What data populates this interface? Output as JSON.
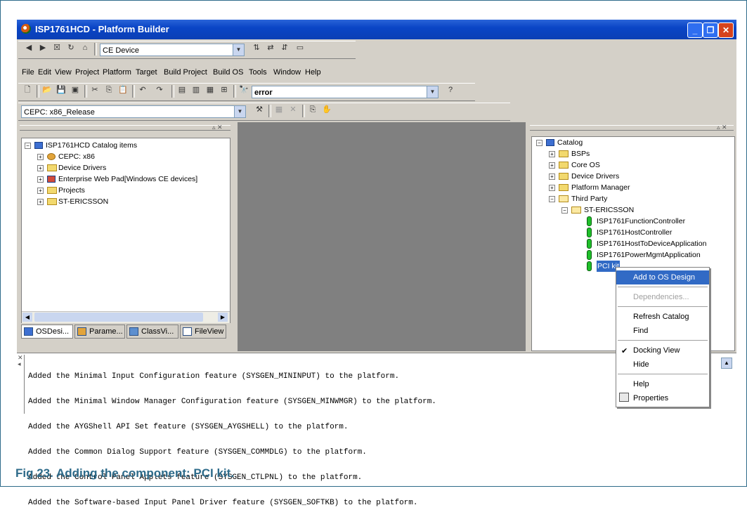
{
  "window": {
    "title": "ISP1761HCD - Platform Builder"
  },
  "toolbar1": {
    "device_combo": "CE Device"
  },
  "menu": [
    "File",
    "Edit",
    "View",
    "Project",
    "Platform",
    "Target",
    "Build Project",
    "Build OS",
    "Tools",
    "Window",
    "Help"
  ],
  "toolbar2": {
    "search_combo": "error"
  },
  "toolbar3": {
    "config_combo": "CEPC: x86_Release"
  },
  "left_tree": {
    "root": "ISP1761HCD Catalog items",
    "items": [
      "CEPC: x86",
      "Device Drivers",
      "Enterprise Web Pad[Windows CE devices]",
      "Projects",
      "ST-ERICSSON"
    ]
  },
  "left_tabs": [
    "OSDesi...",
    "Parame...",
    "ClassVi...",
    "FileView"
  ],
  "catalog": {
    "root": "Catalog",
    "items": [
      "BSPs",
      "Core OS",
      "Device Drivers",
      "Platform Manager",
      "Third Party"
    ],
    "vendor": "ST-ERICSSON",
    "components": [
      "ISP1761FunctionController",
      "ISP1761HostController",
      "ISP1761HostToDeviceApplication",
      "ISP1761PowerMgmtApplication",
      "PCI kit"
    ]
  },
  "context_menu": {
    "items": [
      {
        "label": "Add to OS Design",
        "state": "highlighted"
      },
      {
        "label": "Dependencies...",
        "state": "disabled"
      },
      {
        "label": "Refresh Catalog",
        "state": "normal"
      },
      {
        "label": "Find",
        "state": "normal"
      },
      {
        "label": "Docking View",
        "state": "checked"
      },
      {
        "label": "Hide",
        "state": "normal"
      },
      {
        "label": "Help",
        "state": "normal"
      },
      {
        "label": "Properties",
        "state": "normal"
      }
    ]
  },
  "output_lines": [
    "Added the Minimal Input Configuration feature (SYSGEN_MININPUT) to the platform.",
    "Added the Minimal Window Manager Configuration feature (SYSGEN_MINWMGR) to the platform.",
    "Added the AYGShell API Set feature (SYSGEN_AYGSHELL) to the platform.",
    "Added the Common Dialog Support feature (SYSGEN_COMMDLG) to the platform.",
    "Added the Control Panel Applets feature (SYSGEN_CTLPNL) to the platform.",
    "Added the Software-based Input Panel Driver feature (SYSGEN_SOFTKB) to the platform."
  ],
  "caption": "Fig 23. Adding the component: PCI kit."
}
